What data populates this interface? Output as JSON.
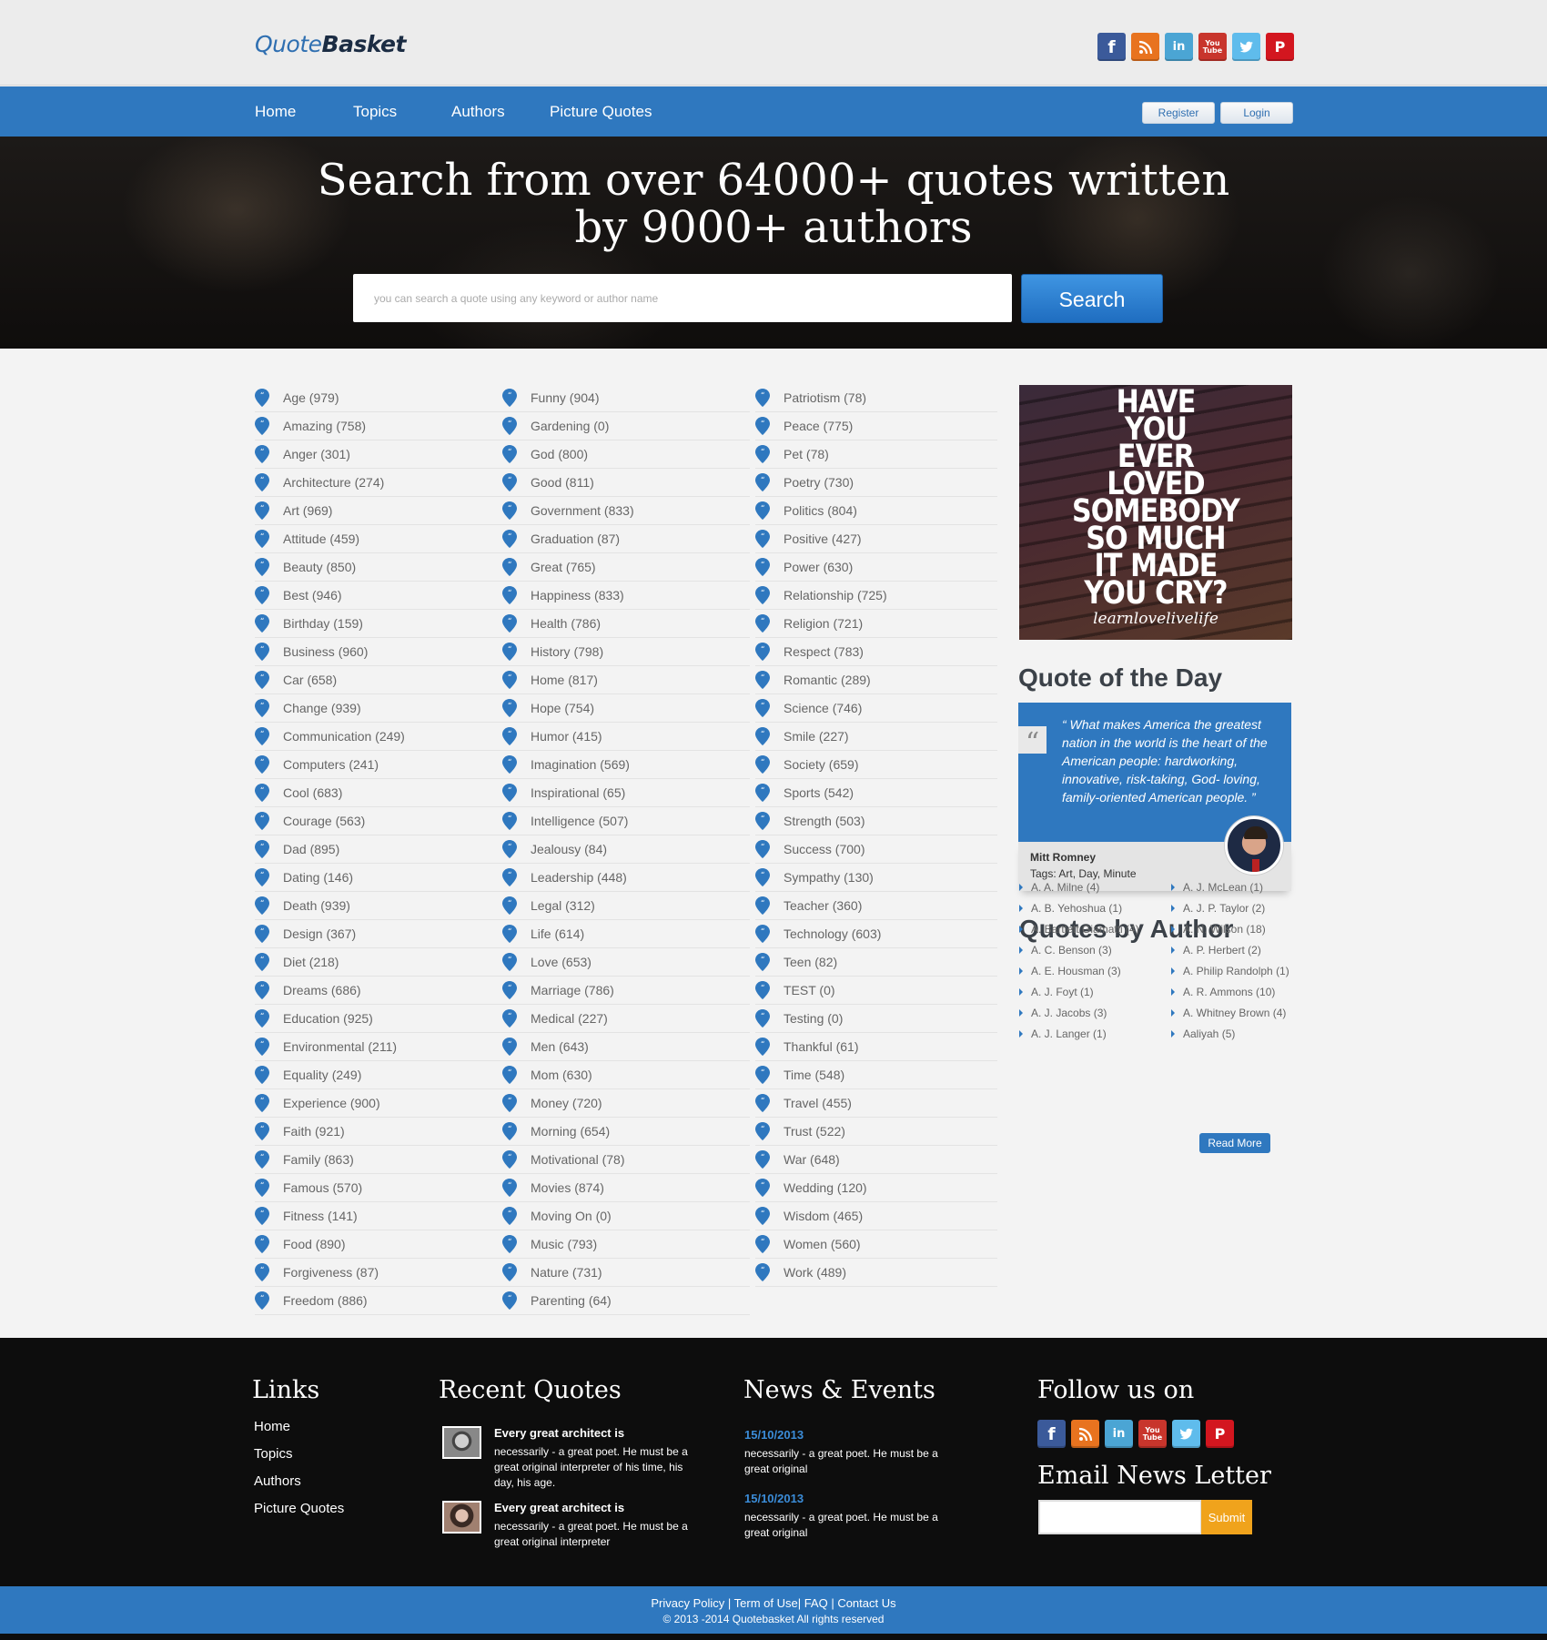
{
  "logo": {
    "part1": "Quote",
    "part2": "Basket"
  },
  "social_icons": [
    "facebook-icon",
    "rss-icon",
    "linkedin-icon",
    "youtube-icon",
    "twitter-icon",
    "pinterest-icon"
  ],
  "social_glyphs": {
    "facebook": "f",
    "linkedin": "in",
    "youtube": "You Tube",
    "pinterest": "P"
  },
  "nav": {
    "items": [
      "Home",
      "Topics",
      "Authors",
      "Picture Quotes"
    ],
    "register": "Register",
    "login": "Login"
  },
  "hero": {
    "title_line1": "Search from over 64000+ quotes written",
    "title_line2": "by 9000+ authors",
    "search_placeholder": "you can search a quote using any keyword or author name",
    "search_button": "Search"
  },
  "categories": {
    "col1": [
      "Age (979)",
      "Amazing (758)",
      "Anger (301)",
      "Architecture (274)",
      "Art (969)",
      "Attitude (459)",
      "Beauty (850)",
      "Best (946)",
      "Birthday (159)",
      "Business (960)",
      "Car (658)",
      "Change (939)",
      "Communication (249)",
      "Computers (241)",
      "Cool (683)",
      "Courage (563)",
      "Dad (895)",
      "Dating (146)",
      "Death (939)",
      "Design (367)",
      "Diet (218)",
      "Dreams (686)",
      "Education (925)",
      "Environmental (211)",
      "Equality (249)",
      "Experience (900)",
      "Faith (921)",
      "Family (863)",
      "Famous (570)",
      "Fitness (141)",
      "Food (890)",
      "Forgiveness (87)",
      "Freedom (886)"
    ],
    "col2": [
      "Funny (904)",
      "Gardening (0)",
      "God (800)",
      "Good (811)",
      "Government (833)",
      "Graduation (87)",
      "Great (765)",
      "Happiness (833)",
      "Health (786)",
      "History (798)",
      "Home (817)",
      "Hope (754)",
      "Humor (415)",
      "Imagination (569)",
      "Inspirational (65)",
      "Intelligence (507)",
      "Jealousy (84)",
      "Leadership (448)",
      "Legal (312)",
      "Life (614)",
      "Love (653)",
      "Marriage (786)",
      "Medical (227)",
      "Men (643)",
      "Mom (630)",
      "Money (720)",
      "Morning (654)",
      "Motivational (78)",
      "Movies (874)",
      "Moving On (0)",
      "Music (793)",
      "Nature (731)",
      "Parenting (64)"
    ],
    "col3": [
      "Patriotism (78)",
      "Peace (775)",
      "Pet (78)",
      "Poetry (730)",
      "Politics (804)",
      "Positive (427)",
      "Power (630)",
      "Relationship (725)",
      "Religion (721)",
      "Respect (783)",
      "Romantic (289)",
      "Science (746)",
      "Smile (227)",
      "Society (659)",
      "Sports (542)",
      "Strength (503)",
      "Success (700)",
      "Sympathy (130)",
      "Teacher (360)",
      "Technology (603)",
      "Teen (82)",
      "TEST (0)",
      "Testing (0)",
      "Thankful (61)",
      "Time (548)",
      "Travel (455)",
      "Trust (522)",
      "War (648)",
      "Wedding (120)",
      "Wisdom (465)",
      "Women (560)",
      "Work (489)"
    ]
  },
  "promo": {
    "text": "HAVE\nYOU\nEVER\nLOVED\nSOMEBODY\nSO MUCH\nIT MADE\nYOU CRY?",
    "signature": "learnlovelivelife"
  },
  "quote_of_day": {
    "heading": "Quote of the Day",
    "quote_mark": "“",
    "text": "“ What makes America the greatest nation in the world is the heart of the American people: hardworking, innovative, risk-taking, God- loving, family-oriented American people. ”",
    "author": "Mitt Romney",
    "tags": "Tags: Art, Day, Minute"
  },
  "quotes_by_author": {
    "heading": "Quotes by Author",
    "col1": [
      "A. A. Milne (4)",
      "A. B. Yehoshua (1)",
      "A. Bartlett Giamatti (4)",
      "A. C. Benson (3)",
      "A. E. Housman (3)",
      "A. J. Foyt (1)",
      "A. J. Jacobs (3)",
      "A. J. Langer (1)"
    ],
    "col2": [
      "A. J. McLean (1)",
      "A. J. P. Taylor (2)",
      "A. N. Wilson (18)",
      "A. P. Herbert (2)",
      "A. Philip Randolph (1)",
      "A. R. Ammons (10)",
      "A. Whitney Brown (4)",
      "Aaliyah (5)"
    ],
    "read_more": "Read More"
  },
  "footer": {
    "links_title": "Links",
    "links": [
      "Home",
      "Topics",
      "Authors",
      "Picture Quotes"
    ],
    "recent_title": "Recent Quotes",
    "recent": [
      {
        "head": "Every great architect is",
        "body": "necessarily - a great poet. He must be a great original interpreter of his time, his day, his age."
      },
      {
        "head": "Every great architect is",
        "body": "necessarily - a great poet. He must be a great original interpreter"
      }
    ],
    "news_title": "News & Events",
    "news": [
      {
        "date": "15/10/2013",
        "body": "necessarily - a great poet. He must be a great original"
      },
      {
        "date": "15/10/2013",
        "body": "necessarily - a great poet. He must be a great original"
      }
    ],
    "follow_title": "Follow us on",
    "newsletter_title": "Email News Letter",
    "submit": "Submit"
  },
  "copyright": {
    "links": "Privacy Policy | Term of Use| FAQ | Contact Us",
    "text": "© 2013 -2014 Quotebasket All rights reserved"
  },
  "colors": {
    "brand_blue": "#2f78bf",
    "footer_bg": "#0d0d0d",
    "submit_orange": "#f0a31c"
  }
}
